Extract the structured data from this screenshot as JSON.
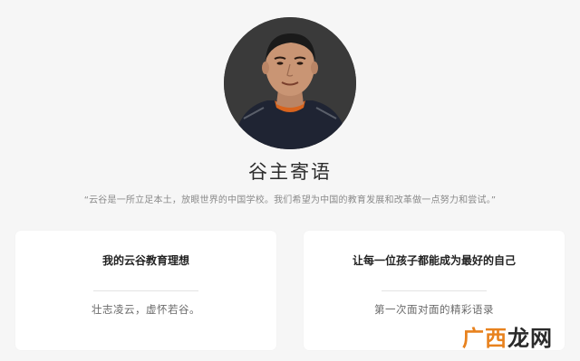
{
  "profile": {
    "avatar_icon": "portrait-photo"
  },
  "header": {
    "title": "谷主寄语",
    "quote": "“云谷是一所立足本土，放眼世界的中国学校。我们希望为中国的教育发展和改革做一点努力和尝试。”"
  },
  "cards": [
    {
      "title": "我的云谷教育理想",
      "subtitle": "壮志凌云，虚怀若谷。"
    },
    {
      "title": "让每一位孩子都能成为最好的自己",
      "subtitle": "第一次面对面的精彩语录"
    }
  ],
  "watermark": {
    "part1": "广西",
    "part2": "龙网",
    "colors": {
      "part1": "#e8821e",
      "part2": "#2a2a2a"
    }
  },
  "colors": {
    "background": "#f6f6f6",
    "card": "#ffffff"
  }
}
